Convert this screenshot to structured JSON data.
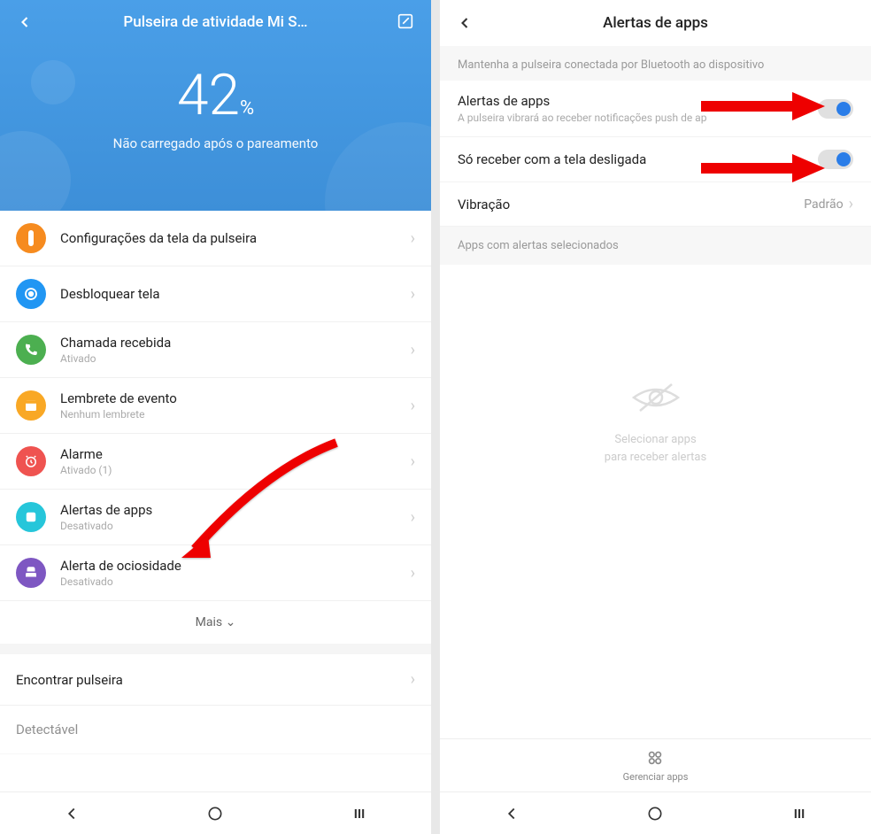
{
  "left": {
    "topbar": {
      "title": "Pulseira de atividade Mi S…"
    },
    "battery": {
      "value": "42",
      "pct": "%",
      "sub": "Não carregado após o pareamento"
    },
    "rows": [
      {
        "title": "Configurações da tela da pulseira",
        "sub": ""
      },
      {
        "title": "Desbloquear tela",
        "sub": ""
      },
      {
        "title": "Chamada recebida",
        "sub": "Ativado"
      },
      {
        "title": "Lembrete de evento",
        "sub": "Nenhum lembrete"
      },
      {
        "title": "Alarme",
        "sub": "Ativado (1)"
      },
      {
        "title": "Alertas de apps",
        "sub": "Desativado"
      },
      {
        "title": "Alerta de ociosidade",
        "sub": "Desativado"
      }
    ],
    "more": "Mais",
    "extra": [
      {
        "title": "Encontrar pulseira"
      },
      {
        "title": "Detectável"
      }
    ]
  },
  "right": {
    "title": "Alertas de apps",
    "hint": "Mantenha a pulseira conectada por Bluetooth ao dispositivo",
    "rows": {
      "alerts": {
        "title": "Alertas de apps",
        "sub": "A pulseira vibrará ao receber notificações push de ap"
      },
      "screen_off": {
        "title": "Só receber com a tela desligada"
      },
      "vibration": {
        "title": "Vibração",
        "value": "Padrão"
      }
    },
    "section": "Apps com alertas selecionados",
    "empty": {
      "line1": "Selecionar apps",
      "line2": "para receber alertas"
    },
    "bottom": {
      "label": "Gerenciar apps"
    }
  }
}
